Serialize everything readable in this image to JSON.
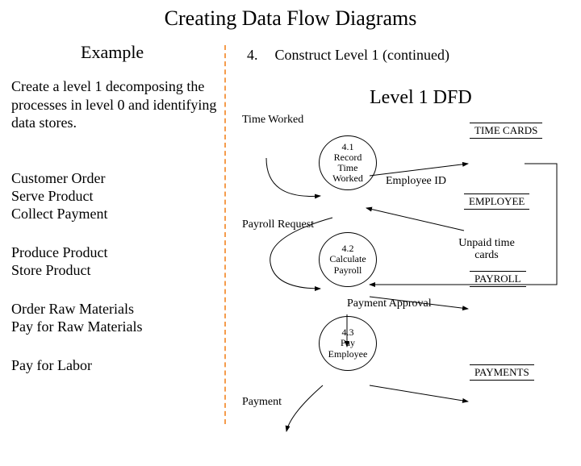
{
  "title": "Creating Data Flow Diagrams",
  "subtitle": "Example",
  "step": {
    "num": "4.",
    "text": "Construct Level 1 (continued)"
  },
  "dfd_title": "Level 1 DFD",
  "left": {
    "desc": "Create a level 1 decomposing the processes in level 0 and identifying data stores.",
    "g1a": "Customer Order",
    "g1b": "Serve Product",
    "g1c": "Collect Payment",
    "g2a": "Produce Product",
    "g2b": "Store Product",
    "g3a": "Order Raw Materials",
    "g3b": "Pay for Raw Materials",
    "g4a": "Pay for Labor"
  },
  "labels": {
    "time_worked": "Time Worked",
    "payroll_request": "Payroll Request",
    "employee_id": "Employee ID",
    "payment_approval": "Payment  Approval",
    "unpaid_time_cards": "Unpaid time cards",
    "payment": "Payment"
  },
  "processes": {
    "p41_id": "4.1",
    "p41_name": "Record Time Worked",
    "p42_id": "4.2",
    "p42_name": "Calculate Payroll",
    "p43_id": "4.3",
    "p43_name": "Pay Employee"
  },
  "stores": {
    "time_cards": "TIME CARDS",
    "employee": "EMPLOYEE",
    "payroll": "PAYROLL",
    "payments": "PAYMENTS"
  }
}
